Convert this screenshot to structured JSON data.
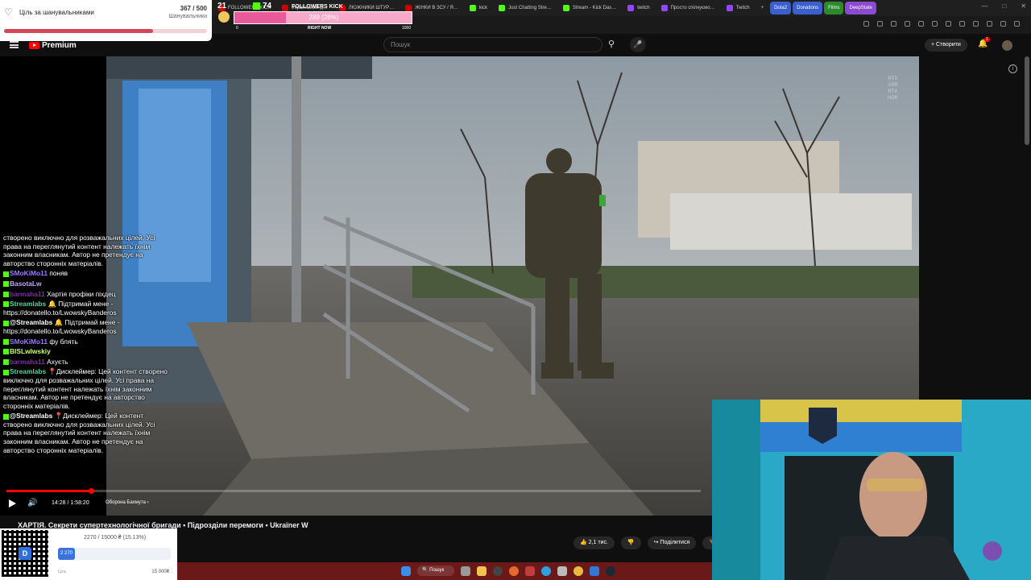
{
  "browser": {
    "tabs": [
      {
        "label": "FOLLOWERS KICK",
        "color": "#c00"
      },
      {
        "label": "Український д…",
        "color": "#c00"
      },
      {
        "label": "ЛЮЖНИКИ ШТУР…",
        "color": "#c00"
      },
      {
        "label": "ЖІНКИ В ЗСУ / Я…",
        "color": "#c00"
      },
      {
        "label": "kick",
        "color": "#53fc18"
      },
      {
        "label": "Just Chatting Stre…",
        "color": "#53fc18"
      },
      {
        "label": "Stream - Kick Das…",
        "color": "#53fc18"
      },
      {
        "label": "twitch",
        "color": "#9146ff"
      },
      {
        "label": "Просто спілкуємо…",
        "color": "#9146ff"
      },
      {
        "label": "Twitch",
        "color": "#9146ff"
      }
    ],
    "bookmarks": [
      {
        "label": "Dota2",
        "style": "bm"
      },
      {
        "label": "Donations",
        "style": "bm"
      },
      {
        "label": "Films",
        "style": "bm k"
      },
      {
        "label": "DeepState",
        "style": "bm t"
      }
    ],
    "window_controls": [
      "—",
      "□",
      "✕"
    ]
  },
  "youtube": {
    "logo_text": "Premium",
    "search_placeholder": "Пошук",
    "create_label": "+ Створити",
    "notification_count": "1",
    "video_title": "ХАРТІЯ. Секрети супертехнологічної бригади • Підрозділи перемоги • Ukraїner W",
    "time": "14:28 / 1:58:20",
    "chapter": "Оборона Бахмута ›",
    "progress_fraction": 0.1223,
    "likes_label": "👍 2,1 тис.",
    "dislike_label": "👎",
    "share_label": "↪ Поділитися",
    "save_label": "🔖",
    "watermark": "RTX\nVSR\nRTX\nHDR"
  },
  "follower_goal": {
    "title": "Ціль за шанувальниками",
    "count": "367 / 500",
    "subtitle": "Шанувальники",
    "fraction": 0.734
  },
  "kick_overlay": {
    "twitch_count": "21",
    "kick_count": "74",
    "label": "FOLLOWERS KICK",
    "value": "289 (28%)",
    "fraction": 0.289,
    "min": "0",
    "now": "RIGHT NOW",
    "max": "1000"
  },
  "chat": [
    {
      "name": "",
      "text": "створено виключно для розважальних цілей. Усі права на переглянутий контент належать їхнім законним власникам. Автор не претендує на авторство сторонніх матеріалів.",
      "color": "#fff"
    },
    {
      "name": "SMoKiMo11",
      "text": "поняв",
      "color": "#9b7bff"
    },
    {
      "name": "BasotaLw",
      "text": "",
      "color": "#c6a2ff"
    },
    {
      "name": "barmaha11",
      "text": "Хартія профіки піхдец",
      "color": "#7d2fa0"
    },
    {
      "name": "Streamlabs",
      "text": "🔔 Підтримай мене - https://donatello.to/LwowskyBanderos",
      "color": "#53d4a5"
    },
    {
      "name": "@Streamlabs",
      "text": "🔔 Підтримай мене - https://donatello.to/LwowskyBanderos",
      "color": "#fff"
    },
    {
      "name": "SMoKiMo11",
      "text": "фу блять",
      "color": "#9b7bff"
    },
    {
      "name": "BISLwlwskiy",
      "text": "",
      "color": "#c6ff7a"
    },
    {
      "name": "barmaha11",
      "text": "Ахуєть",
      "color": "#7d2fa0"
    },
    {
      "name": "Streamlabs",
      "text": "📍Дисклеймер: Цей контент створено виключно для розважальних цілей. Усі права на переглянутий контент належать їхнім законним власникам. Автор не претендує на авторство сторонніх матеріалів.",
      "color": "#53d4a5"
    },
    {
      "name": "@Streamlabs",
      "text": "📍Дисклеймер: Цей контент створено виключно для розважальних цілей. Усі права на переглянутий контент належать їхнім законним власникам. Автор не претендує на авторство сторонніх матеріалів.",
      "color": "#fff"
    }
  ],
  "donation": {
    "title": "2270 / 15000 ₴ (15.13%)",
    "bar_label": "2 270",
    "fraction": 0.1513,
    "min": "Ціль",
    "max": "15 000₴"
  },
  "taskbar": {
    "search_label": "🔍 Пошук"
  }
}
